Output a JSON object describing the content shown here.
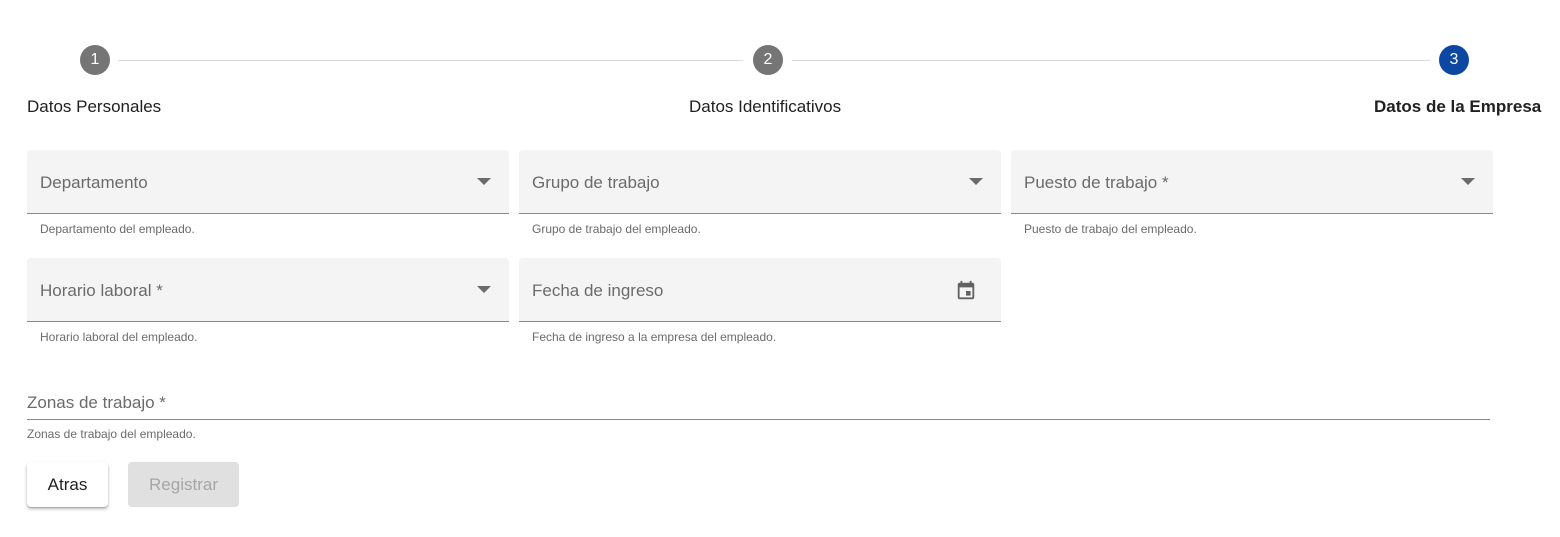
{
  "stepper": {
    "steps": [
      {
        "number": "1",
        "label": "Datos Personales",
        "state": "done"
      },
      {
        "number": "2",
        "label": "Datos Identificativos",
        "state": "done"
      },
      {
        "number": "3",
        "label": "Datos de la Empresa",
        "state": "active"
      }
    ],
    "colors": {
      "done": "#757575",
      "active": "#0d47a1"
    }
  },
  "form": {
    "departamento": {
      "label": "Departamento",
      "hint": "Departamento del empleado.",
      "icon": "chevron-down-icon"
    },
    "grupo": {
      "label": "Grupo de trabajo",
      "hint": "Grupo de trabajo del empleado.",
      "icon": "chevron-down-icon"
    },
    "puesto": {
      "label": "Puesto de trabajo *",
      "hint": "Puesto de trabajo del empleado.",
      "icon": "chevron-down-icon"
    },
    "horario": {
      "label": "Horario laboral *",
      "hint": "Horario laboral del empleado.",
      "icon": "chevron-down-icon"
    },
    "fecha": {
      "label": "Fecha de ingreso",
      "hint": "Fecha de ingreso a la empresa del empleado.",
      "icon": "calendar-icon"
    },
    "zonas": {
      "label": "Zonas de trabajo *",
      "hint": "Zonas de trabajo del empleado."
    }
  },
  "actions": {
    "back_label": "Atras",
    "register_label": "Registrar",
    "register_disabled": true
  }
}
